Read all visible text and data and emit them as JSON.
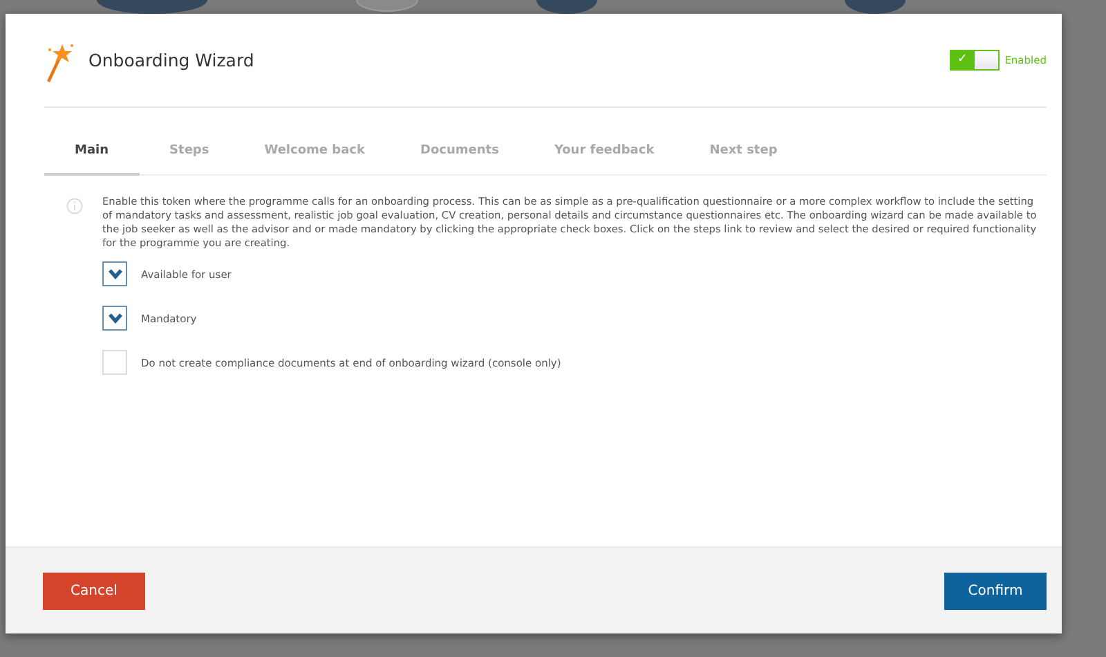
{
  "dialog": {
    "title": "Onboarding Wizard",
    "toggle": {
      "on": true,
      "symbol": "✓",
      "label": "Enabled"
    }
  },
  "tabs": [
    {
      "label": "Main",
      "selected": true
    },
    {
      "label": "Steps",
      "selected": false
    },
    {
      "label": "Welcome back",
      "selected": false
    },
    {
      "label": "Documents",
      "selected": false
    },
    {
      "label": "Your feedback",
      "selected": false
    },
    {
      "label": "Next step",
      "selected": false
    }
  ],
  "description": "Enable this token where the programme calls for an onboarding process. This can be as simple as a pre-qualification questionnaire or a more complex workflow to include the setting of mandatory tasks and assessment, realistic job goal evaluation, CV creation, personal details and circumstance questionnaires etc. The onboarding wizard can be made available to the job seeker as well as the advisor and or made mandatory by clicking the appropriate check boxes. Click on the steps link to review and select the desired or required functionality for the programme you are creating.",
  "options": [
    {
      "label": "Available for user",
      "checked": true
    },
    {
      "label": "Mandatory",
      "checked": true
    },
    {
      "label": "Do not create compliance documents at end of onboarding wizard (console only)",
      "checked": false
    }
  ],
  "buttons": {
    "cancel": "Cancel",
    "confirm": "Confirm"
  }
}
